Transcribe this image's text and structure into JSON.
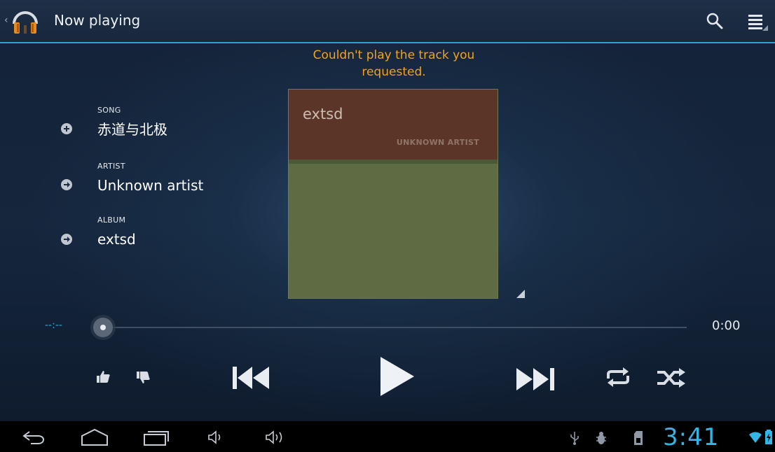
{
  "app_bar": {
    "title": "Now playing",
    "app_icon": "headphones-icon",
    "actions": [
      "search-icon",
      "menu-icon"
    ]
  },
  "error_message": "Couldn't play the track you requested.",
  "track_info": {
    "song_label": "SONG",
    "song_value": "赤道与北极",
    "artist_label": "ARTIST",
    "artist_value": "Unknown artist",
    "album_label": "ALBUM",
    "album_value": "extsd"
  },
  "album_art": {
    "album_text": "extsd",
    "artist_text": "UNKNOWN ARTIST",
    "colors": {
      "top": "#5b3628",
      "bottom": "#5e6b43"
    }
  },
  "progress": {
    "elapsed": "--:--",
    "total": "0:00",
    "position_fraction": 0
  },
  "controls": {
    "icons": [
      "thumbs-up-icon",
      "thumbs-down-icon",
      "previous-icon",
      "play-icon",
      "next-icon",
      "repeat-icon",
      "shuffle-icon"
    ]
  },
  "system_bar": {
    "clock": "3:41",
    "nav_icons": [
      "back-icon",
      "home-icon",
      "recent-apps-icon",
      "volume-down-icon",
      "volume-up-icon"
    ],
    "status_icons": [
      "usb-icon",
      "debug-icon",
      "sd-card-icon",
      "wifi-icon",
      "battery-icon"
    ]
  },
  "colors": {
    "accent": "#33b5e5",
    "error": "#f4a21c",
    "action_bar": "#1b2a40",
    "background": "#142238"
  }
}
